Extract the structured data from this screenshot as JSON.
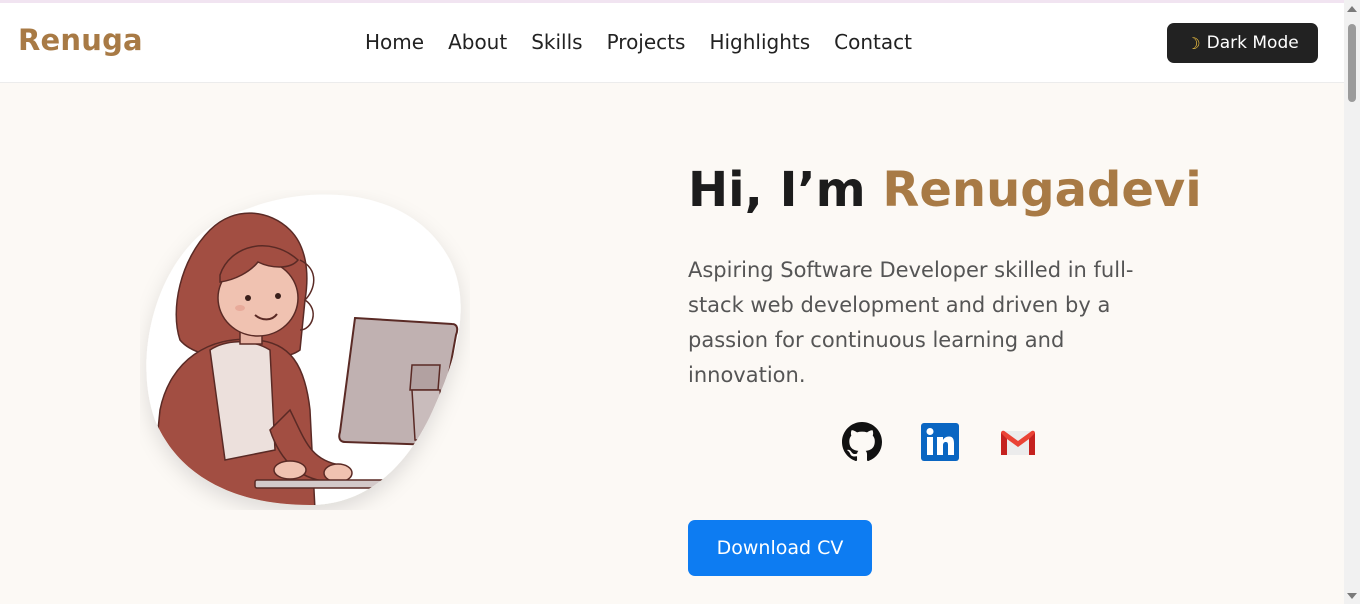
{
  "brand": "Renuga",
  "nav": {
    "items": [
      {
        "label": "Home"
      },
      {
        "label": "About"
      },
      {
        "label": "Skills"
      },
      {
        "label": "Projects"
      },
      {
        "label": "Highlights"
      },
      {
        "label": "Contact"
      }
    ],
    "dark_mode_label": "Dark Mode",
    "dark_mode_icon": "moon-icon"
  },
  "hero": {
    "greeting": "Hi, I’m",
    "name": "Renugadevi",
    "description": "Aspiring Software Developer skilled in full-stack web development and driven by a passion for continuous learning and innovation.",
    "download_label": "Download CV",
    "socials": [
      {
        "icon": "github-icon"
      },
      {
        "icon": "linkedin-icon"
      },
      {
        "icon": "gmail-icon"
      }
    ]
  },
  "colors": {
    "accent": "#a87a45",
    "button_primary": "#0d7cf2",
    "dark_button": "#222222",
    "background": "#fcf9f5"
  }
}
